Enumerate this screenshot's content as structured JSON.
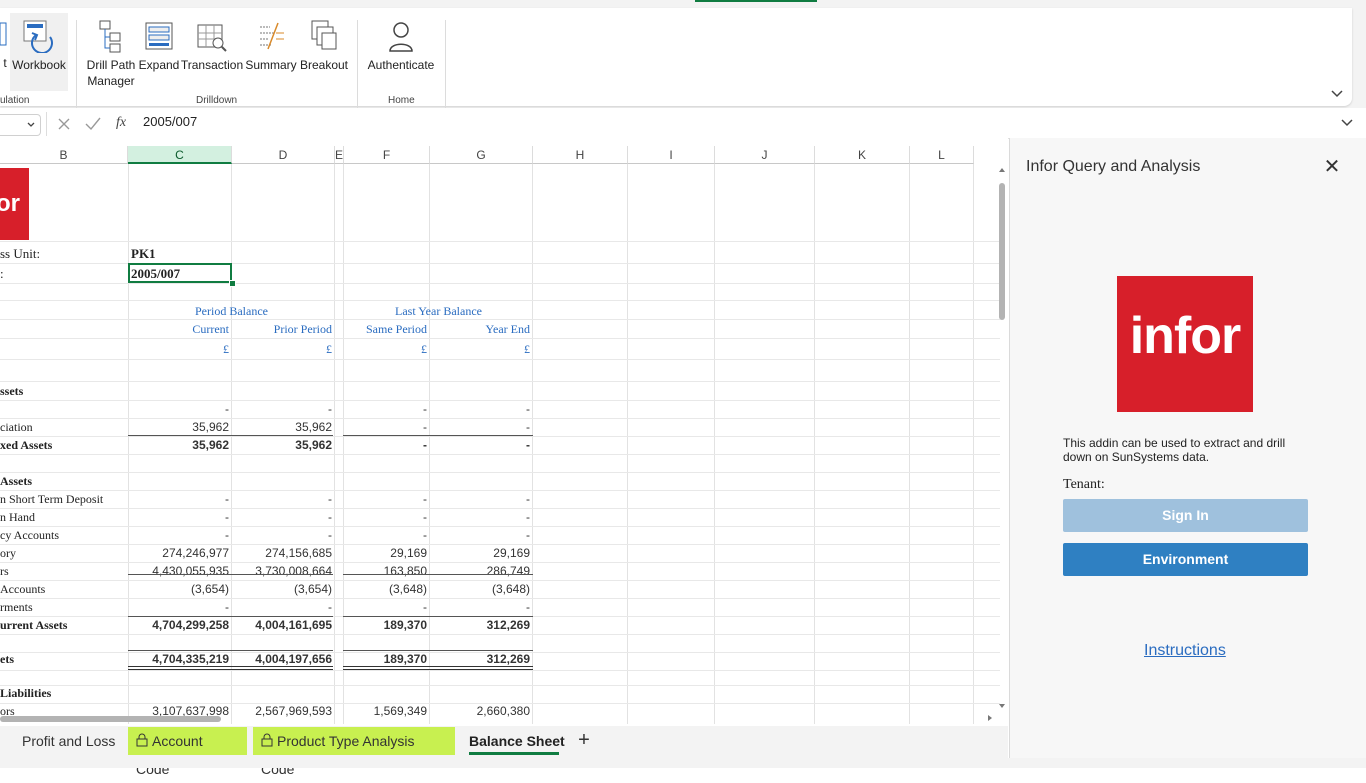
{
  "ribbon": {
    "groups": [
      {
        "label": "ulation",
        "buttons": [
          {
            "label": "t"
          },
          {
            "label": "Workbook"
          }
        ]
      },
      {
        "label": "Drilldown",
        "buttons": [
          {
            "label": "Drill Path Manager"
          },
          {
            "label": "Expand"
          },
          {
            "label": "Transaction"
          },
          {
            "label": "Summary"
          },
          {
            "label": "Breakout"
          }
        ]
      },
      {
        "label": "Home",
        "buttons": [
          {
            "label": "Authenticate"
          }
        ]
      }
    ]
  },
  "formula_bar": {
    "fx": "fx",
    "value": "2005/007"
  },
  "columns": [
    "B",
    "C",
    "D",
    "E",
    "F",
    "G",
    "H",
    "I",
    "J",
    "K",
    "L"
  ],
  "sheet": {
    "logo_text": "or",
    "business_unit_label": "ss Unit:",
    "business_unit_value": "PK1",
    "period_label": ":",
    "period_value": "2005/007",
    "period_balance": "Period Balance",
    "last_year_balance": "Last Year Balance",
    "current": "Current",
    "prior_period": "Prior Period",
    "same_period": "Same Period",
    "year_end": "Year End",
    "currency": "£",
    "rows": [
      {
        "label": "ssets",
        "vals": [
          "",
          "",
          "",
          ""
        ],
        "bold": true
      },
      {
        "label": "",
        "vals": [
          "-",
          "-",
          "-",
          "-"
        ]
      },
      {
        "label": "ciation",
        "vals": [
          "35,962",
          "35,962",
          "-",
          "-"
        ]
      },
      {
        "label": "xed Assets",
        "vals": [
          "35,962",
          "35,962",
          "-",
          "-"
        ],
        "bold": true
      },
      {
        "label": " Assets",
        "vals": [
          "",
          "",
          "",
          ""
        ],
        "bold": true
      },
      {
        "label": "n Short Term Deposit",
        "vals": [
          "-",
          "-",
          "-",
          "-"
        ]
      },
      {
        "label": "n Hand",
        "vals": [
          "-",
          "-",
          "-",
          "-"
        ]
      },
      {
        "label": "cy Accounts",
        "vals": [
          "-",
          "-",
          "-",
          "-"
        ]
      },
      {
        "label": "ory",
        "vals": [
          "274,246,977",
          "274,156,685",
          "29,169",
          "29,169"
        ]
      },
      {
        "label": "rs",
        "vals": [
          "4,430,055,935",
          "3,730,008,664",
          "163,850",
          "286,749"
        ]
      },
      {
        "label": " Accounts",
        "vals": [
          "(3,654)",
          "(3,654)",
          "(3,648)",
          "(3,648)"
        ]
      },
      {
        "label": "rments",
        "vals": [
          "-",
          "-",
          "-",
          "-"
        ]
      },
      {
        "label": "urrent Assets",
        "vals": [
          "4,704,299,258",
          "4,004,161,695",
          "189,370",
          "312,269"
        ],
        "bold": true
      },
      {
        "label": "ets",
        "vals": [
          "4,704,335,219",
          "4,004,197,656",
          "189,370",
          "312,269"
        ],
        "bold": true
      },
      {
        "label": " Liabilities",
        "vals": [
          "",
          "",
          "",
          ""
        ],
        "bold": true
      },
      {
        "label": "ors",
        "vals": [
          "3,107,637,998",
          "2,567,969,593",
          "1,569,349",
          "2,660,380"
        ]
      }
    ]
  },
  "sheet_tabs": [
    {
      "label": "Profit and Loss",
      "locked": false,
      "active": false
    },
    {
      "label": "Account Code",
      "locked": true,
      "active": false
    },
    {
      "label": "Product Type Analysis Code",
      "locked": true,
      "active": false
    },
    {
      "label": "Balance Sheet",
      "locked": false,
      "active": true
    }
  ],
  "add_sheet": "+",
  "taskpane": {
    "title": "Infor Query and Analysis",
    "close": "✕",
    "logo_text": "infor",
    "description": "This addin can be used to extract and drill down on SunSystems data.",
    "tenant_label": "Tenant:",
    "signin_label": "Sign In",
    "environment_label": "Environment",
    "instructions_label": "Instructions"
  },
  "colors": {
    "accent": "#107c41",
    "infor_red": "#d71f2a",
    "button_blue": "#2f80c2",
    "button_disabled": "#9fc1dd",
    "locked_tab": "#c8f050"
  }
}
